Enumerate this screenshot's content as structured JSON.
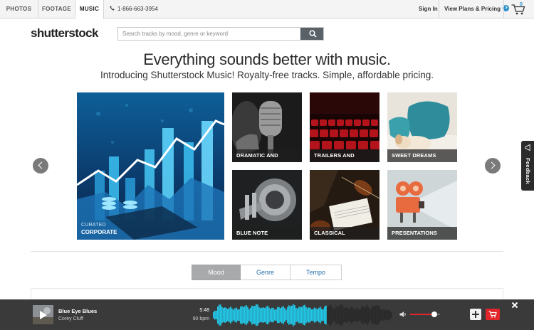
{
  "topbar": {
    "tabs": [
      {
        "label": "PHOTOS",
        "active": false
      },
      {
        "label": "FOOTAGE",
        "active": false
      },
      {
        "label": "MUSIC",
        "active": true
      }
    ],
    "phone": "1-866-663-3954",
    "sign_in": "Sign In",
    "plans": "View Plans & Pricing",
    "cart_count": "0"
  },
  "header": {
    "logo": "shutterstock",
    "search_placeholder": "Search tracks by mood, genre or keyword"
  },
  "hero": {
    "headline": "Everything sounds better with music.",
    "subhead": "Introducing Shutterstock Music! Royalty-free tracks. Simple, affordable pricing."
  },
  "featured": {
    "tag": "CURATED",
    "title": "CORPORATE"
  },
  "tiles": [
    {
      "label": "DRAMATIC AND THEATRIC"
    },
    {
      "label": "TRAILERS AND PROMOS"
    },
    {
      "label": "SWEET DREAMS"
    },
    {
      "label": "BLUE NOTE"
    },
    {
      "label": "CLASSICAL"
    },
    {
      "label": "PRESENTATIONS"
    }
  ],
  "feedback": "Feedback",
  "browse_tabs": [
    {
      "label": "Mood",
      "active": true
    },
    {
      "label": "Genre",
      "active": false
    },
    {
      "label": "Tempo",
      "active": false
    }
  ],
  "player": {
    "title": "Blue Eye Blues",
    "artist": "Corey Cluff",
    "duration": "5:48",
    "bpm": "90 bpm",
    "progress": 0.63,
    "volume": 0.8,
    "colors": {
      "played": "#22c6e6",
      "unplayed": "#2a2a2a",
      "accent": "#e2262b"
    }
  }
}
